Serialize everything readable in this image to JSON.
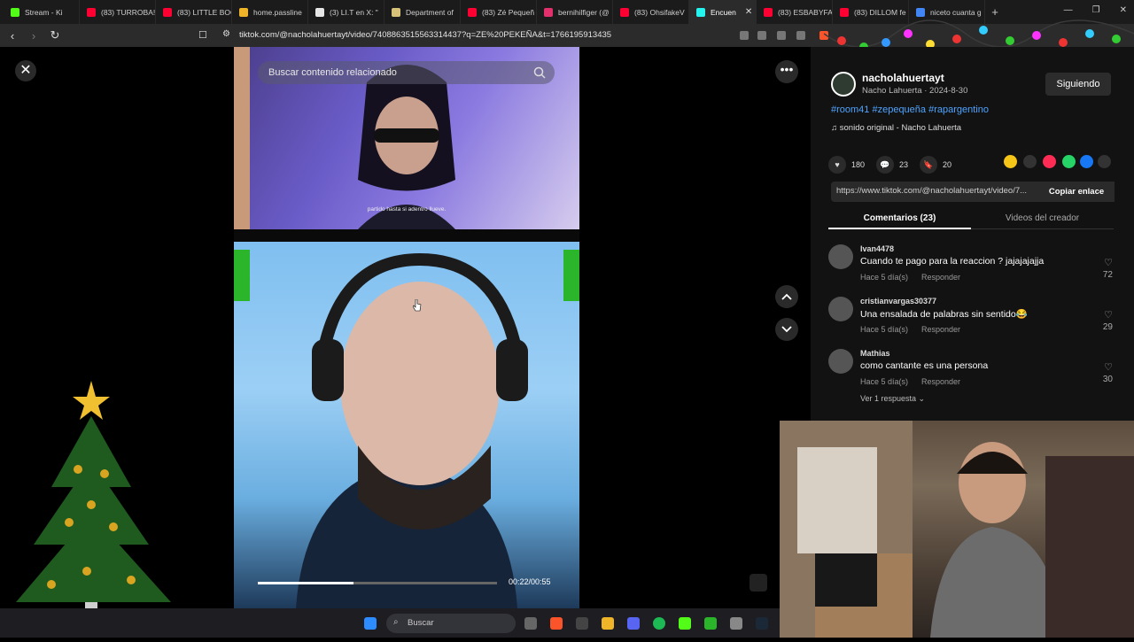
{
  "browser": {
    "tabs": [
      {
        "label": "Stream - Ki",
        "color": "#53fc18"
      },
      {
        "label": "(83) TURROBA!",
        "color": "#ff0033"
      },
      {
        "label": "(83) LITTLE BOO",
        "color": "#ff0033"
      },
      {
        "label": "home.passline",
        "color": "#f0b429"
      },
      {
        "label": "(3) LI.T en X: \"",
        "color": "#e6e6e6"
      },
      {
        "label": "Department of",
        "color": "#d8c27a"
      },
      {
        "label": "(83) Zé Pequeñ",
        "color": "#ff0033"
      },
      {
        "label": "bernihilfiger (@",
        "color": "#e1306c"
      },
      {
        "label": "(83) OhsifakeV",
        "color": "#ff0033"
      },
      {
        "label": "Encuen",
        "color": "#25f4ee",
        "active": true
      },
      {
        "label": "(83) ESBABYFA",
        "color": "#ff0033"
      },
      {
        "label": "(83) DILLOM fe",
        "color": "#ff0033"
      },
      {
        "label": "niceto cuanta g",
        "color": "#4285f4"
      }
    ],
    "url": "tiktok.com/@nacholahuertayt/video/7408863515563314437?q=ZE%20PEKEÑA&t=1766195913435"
  },
  "player": {
    "search_placeholder": "Buscar contenido relacionado",
    "subtitle": "partido hasta si adentro llueve.",
    "time": "00:22/00:55",
    "progress": 0.4
  },
  "panel": {
    "username": "nacholahuertayt",
    "subline": "Nacho Lahuerta · 2024-8-30",
    "follow_label": "Siguiendo",
    "hashtags": "#room41 #zepequeña #rapargentino",
    "sound": "sonido original - Nacho Lahuerta",
    "likes": "180",
    "comments_count": "23",
    "saves": "20",
    "link": "https://www.tiktok.com/@nacholahuertayt/video/7...",
    "copy_label": "Copiar enlace",
    "tab_comments": "Comentarios (23)",
    "tab_videos": "Videos del creador",
    "comments": [
      {
        "user": "Ivan4478",
        "text": "Cuando te pago para la reaccion ? jajajajajja",
        "date": "Hace 5 día(s)",
        "reply": "Responder",
        "likes": "72"
      },
      {
        "user": "cristianvargas30377",
        "text": "Una ensalada de palabras sin sentido😂",
        "date": "Hace 5 día(s)",
        "reply": "Responder",
        "likes": "29"
      },
      {
        "user": "Mathias",
        "text": "como cantante es una persona",
        "date": "Hace 5 día(s)",
        "reply": "Responder",
        "likes": "30"
      }
    ],
    "see_replies": "Ver 1 respuesta ⌄"
  },
  "taskbar": {
    "search_label": "Buscar"
  }
}
